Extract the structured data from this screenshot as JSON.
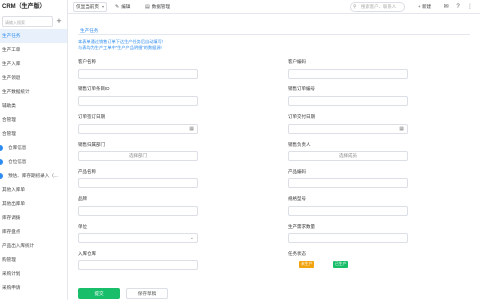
{
  "app": {
    "brand": "CRM（生产版）"
  },
  "sidebar": {
    "search_placeholder": "请输入搜索",
    "items": [
      {
        "label": "生产任务"
      },
      {
        "label": "生产工单"
      },
      {
        "label": "生产入库"
      },
      {
        "label": "生产领退"
      },
      {
        "label": "生产数据统计"
      },
      {
        "label": "辅助类"
      },
      {
        "label": "合管理"
      },
      {
        "label": "合管理"
      },
      {
        "label": "仓库信息"
      },
      {
        "label": "仓位信息"
      },
      {
        "label": "预估、库存期初录入（..."
      },
      {
        "label": "其他入库单"
      },
      {
        "label": "其他出库单"
      },
      {
        "label": "库存调拨"
      },
      {
        "label": "库存盘点"
      },
      {
        "label": "产品出入库统计"
      },
      {
        "label": "购管理"
      },
      {
        "label": "采购计划"
      },
      {
        "label": "采购申请"
      }
    ]
  },
  "topbar": {
    "select_value": "仅显当前页",
    "edit_label": "编辑",
    "data_manage_label": "数据管理",
    "search_placeholder": "搜索客户、联系人",
    "add_label": "+ 新建"
  },
  "form": {
    "tab_label": "生产任务",
    "notes": [
      "本表单通过销售订单下达生产任务后自动填写!",
      "与表均为生产工单中\"生产产品明细\"的数据源!"
    ],
    "labels": {
      "customer_name": "客户名称",
      "customer_code": "客户编码",
      "order_detail_id": "销售订单条目ID",
      "order_no": "销售订单编号",
      "order_date": "订单签订日期",
      "delivery_date": "订单交付日期",
      "sales_dept": "销售归属部门",
      "sales_owner": "销售负责人",
      "product_name": "产品名称",
      "product_code": "产品编码",
      "brand": "品牌",
      "spec": "规格型号",
      "unit": "单位",
      "required_qty": "生产需求数量",
      "warehouse": "入库仓库",
      "status": "任务状态"
    },
    "placeholders": {
      "select_dept": "选择部门",
      "select_user": "选择成员"
    },
    "status_options": [
      {
        "label": "未生产",
        "color": "#f2a40e"
      },
      {
        "label": "已生产",
        "color": "#19be6b"
      }
    ],
    "submit_label": "提交",
    "draft_label": "保存草稿"
  }
}
